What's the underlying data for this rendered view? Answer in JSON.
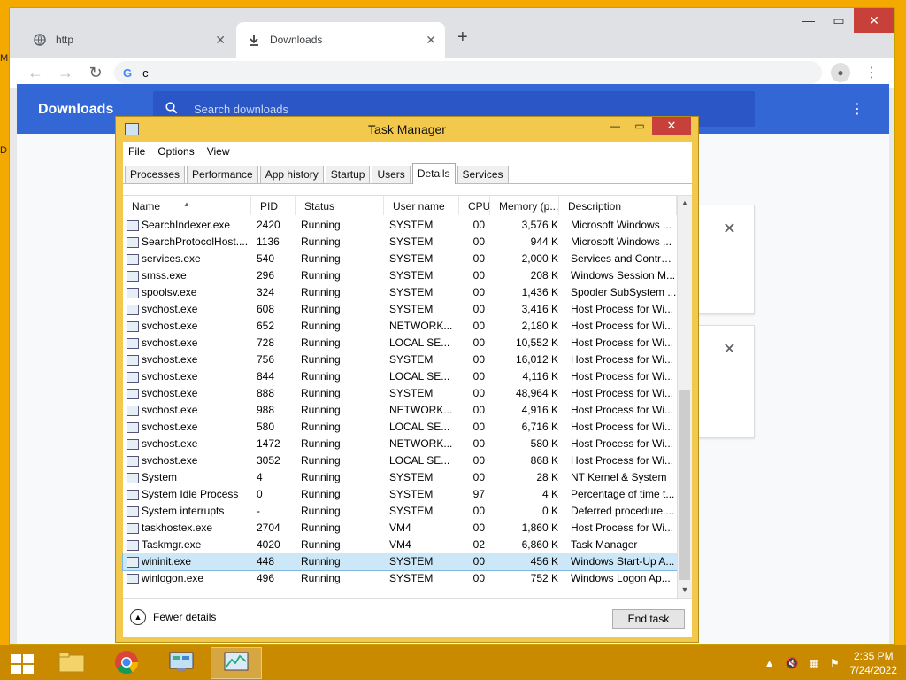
{
  "desktop": {
    "stray1": "M",
    "stray2": "D"
  },
  "chrome": {
    "tabs": [
      {
        "label": "http",
        "icon": "globe-icon"
      },
      {
        "label": "Downloads",
        "icon": "download-icon"
      }
    ],
    "address": "c",
    "downloads_title": "Downloads",
    "search_placeholder": "Search downloads"
  },
  "taskmanager": {
    "title": "Task Manager",
    "menu": [
      "File",
      "Options",
      "View"
    ],
    "tabs": [
      "Processes",
      "Performance",
      "App history",
      "Startup",
      "Users",
      "Details",
      "Services"
    ],
    "active_tab": "Details",
    "columns": [
      "Name",
      "PID",
      "Status",
      "User name",
      "CPU",
      "Memory (p...",
      "Description"
    ],
    "rows": [
      [
        "SearchIndexer.exe",
        "2420",
        "Running",
        "SYSTEM",
        "00",
        "3,576 K",
        "Microsoft Windows ..."
      ],
      [
        "SearchProtocolHost....",
        "1136",
        "Running",
        "SYSTEM",
        "00",
        "944 K",
        "Microsoft Windows ..."
      ],
      [
        "services.exe",
        "540",
        "Running",
        "SYSTEM",
        "00",
        "2,000 K",
        "Services and Control..."
      ],
      [
        "smss.exe",
        "296",
        "Running",
        "SYSTEM",
        "00",
        "208 K",
        "Windows Session M..."
      ],
      [
        "spoolsv.exe",
        "324",
        "Running",
        "SYSTEM",
        "00",
        "1,436 K",
        "Spooler SubSystem ..."
      ],
      [
        "svchost.exe",
        "608",
        "Running",
        "SYSTEM",
        "00",
        "3,416 K",
        "Host Process for Wi..."
      ],
      [
        "svchost.exe",
        "652",
        "Running",
        "NETWORK...",
        "00",
        "2,180 K",
        "Host Process for Wi..."
      ],
      [
        "svchost.exe",
        "728",
        "Running",
        "LOCAL SE...",
        "00",
        "10,552 K",
        "Host Process for Wi..."
      ],
      [
        "svchost.exe",
        "756",
        "Running",
        "SYSTEM",
        "00",
        "16,012 K",
        "Host Process for Wi..."
      ],
      [
        "svchost.exe",
        "844",
        "Running",
        "LOCAL SE...",
        "00",
        "4,116 K",
        "Host Process for Wi..."
      ],
      [
        "svchost.exe",
        "888",
        "Running",
        "SYSTEM",
        "00",
        "48,964 K",
        "Host Process for Wi..."
      ],
      [
        "svchost.exe",
        "988",
        "Running",
        "NETWORK...",
        "00",
        "4,916 K",
        "Host Process for Wi..."
      ],
      [
        "svchost.exe",
        "580",
        "Running",
        "LOCAL SE...",
        "00",
        "6,716 K",
        "Host Process for Wi..."
      ],
      [
        "svchost.exe",
        "1472",
        "Running",
        "NETWORK...",
        "00",
        "580 K",
        "Host Process for Wi..."
      ],
      [
        "svchost.exe",
        "3052",
        "Running",
        "LOCAL SE...",
        "00",
        "868 K",
        "Host Process for Wi..."
      ],
      [
        "System",
        "4",
        "Running",
        "SYSTEM",
        "00",
        "28 K",
        "NT Kernel & System"
      ],
      [
        "System Idle Process",
        "0",
        "Running",
        "SYSTEM",
        "97",
        "4 K",
        "Percentage of time t..."
      ],
      [
        "System interrupts",
        "-",
        "Running",
        "SYSTEM",
        "00",
        "0 K",
        "Deferred procedure ..."
      ],
      [
        "taskhostex.exe",
        "2704",
        "Running",
        "VM4",
        "00",
        "1,860 K",
        "Host Process for Wi..."
      ],
      [
        "Taskmgr.exe",
        "4020",
        "Running",
        "VM4",
        "02",
        "6,860 K",
        "Task Manager"
      ],
      [
        "wininit.exe",
        "448",
        "Running",
        "SYSTEM",
        "00",
        "456 K",
        "Windows Start-Up A..."
      ],
      [
        "winlogon.exe",
        "496",
        "Running",
        "SYSTEM",
        "00",
        "752 K",
        "Windows Logon Ap..."
      ]
    ],
    "selected_row": 20,
    "fewer_details": "Fewer details",
    "end_task": "End task"
  },
  "taskbar": {
    "time": "2:35 PM",
    "date": "7/24/2022"
  }
}
